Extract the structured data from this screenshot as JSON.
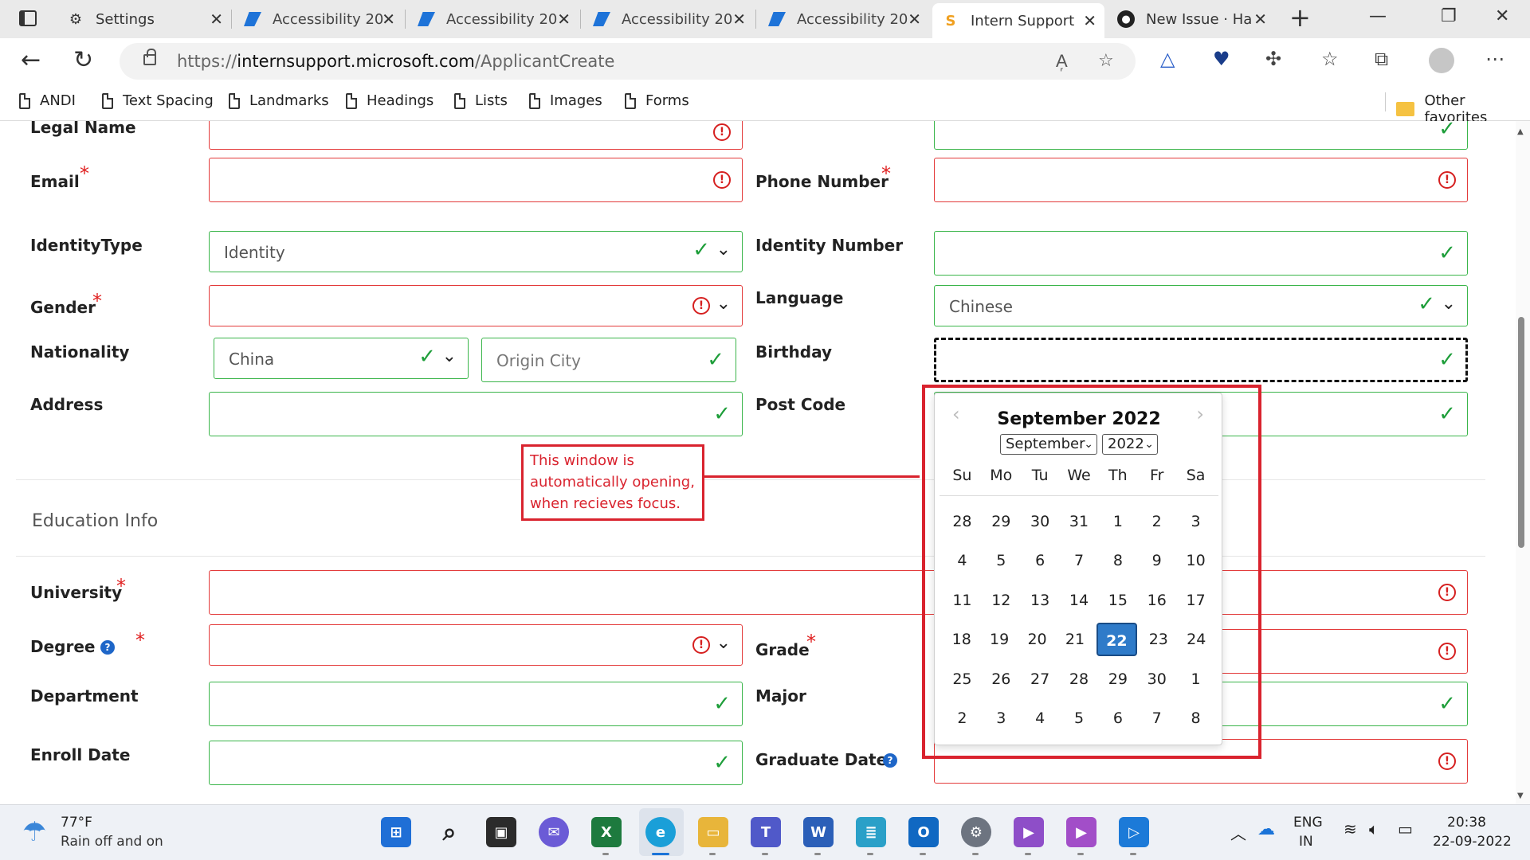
{
  "browser": {
    "tabs": [
      {
        "label": "Settings",
        "icon": "gear-icon"
      },
      {
        "label": "Accessibility 20",
        "icon": "azure-devops-icon"
      },
      {
        "label": "Accessibility 20",
        "icon": "azure-devops-icon"
      },
      {
        "label": "Accessibility 20",
        "icon": "azure-devops-icon"
      },
      {
        "label": "Accessibility 20",
        "icon": "azure-devops-icon"
      },
      {
        "label": "Intern Support",
        "icon": "intern-support-icon",
        "active": true
      },
      {
        "label": "New Issue · Ha",
        "icon": "github-icon"
      }
    ],
    "url_prefix": "https://",
    "url_host": "internsupport.microsoft.com",
    "url_path": "/ApplicantCreate",
    "bookmarks": [
      "ANDI",
      "Text Spacing",
      "Landmarks",
      "Headings",
      "Lists",
      "Images",
      "Forms"
    ],
    "other_favorites": "Other favorites"
  },
  "form": {
    "legal_name_label": "Legal Name",
    "email_label": "Email",
    "phone_label": "Phone Number",
    "identity_type_label": "IdentityType",
    "identity_type_value": "Identity",
    "identity_number_label": "Identity Number",
    "gender_label": "Gender",
    "language_label": "Language",
    "language_value": "Chinese",
    "nationality_label": "Nationality",
    "nationality_value": "China",
    "origin_city_placeholder": "Origin City",
    "birthday_label": "Birthday",
    "address_label": "Address",
    "post_code_label": "Post Code",
    "required_mark": "*",
    "error_mark": "!",
    "help_mark": "?"
  },
  "education": {
    "section_title": "Education Info",
    "university_label": "University",
    "degree_label": "Degree",
    "grade_label": "Grade",
    "department_label": "Department",
    "major_label": "Major",
    "enroll_date_label": "Enroll Date",
    "graduate_date_label": "Graduate Date"
  },
  "annotation": {
    "text": "This window is automatically opening, when recieves focus."
  },
  "datepicker": {
    "title": "September 2022",
    "month_select": "September",
    "year_select": "2022",
    "weekdays": [
      "Su",
      "Mo",
      "Tu",
      "We",
      "Th",
      "Fr",
      "Sa"
    ],
    "weeks": [
      [
        "28",
        "29",
        "30",
        "31",
        "1",
        "2",
        "3"
      ],
      [
        "4",
        "5",
        "6",
        "7",
        "8",
        "9",
        "10"
      ],
      [
        "11",
        "12",
        "13",
        "14",
        "15",
        "16",
        "17"
      ],
      [
        "18",
        "19",
        "20",
        "21",
        "22",
        "23",
        "24"
      ],
      [
        "25",
        "26",
        "27",
        "28",
        "29",
        "30",
        "1"
      ],
      [
        "2",
        "3",
        "4",
        "5",
        "6",
        "7",
        "8"
      ]
    ],
    "selected_day": "22"
  },
  "taskbar": {
    "weather_temp": "77°F",
    "weather_desc": "Rain off and on",
    "language_top": "ENG",
    "language_bottom": "IN",
    "time": "20:38",
    "date": "22-09-2022"
  },
  "colors": {
    "error_border": "#e33a3a",
    "ok_border": "#3ab54a",
    "annotation_red": "#d9232e",
    "selected_day": "#2f7bc9"
  }
}
